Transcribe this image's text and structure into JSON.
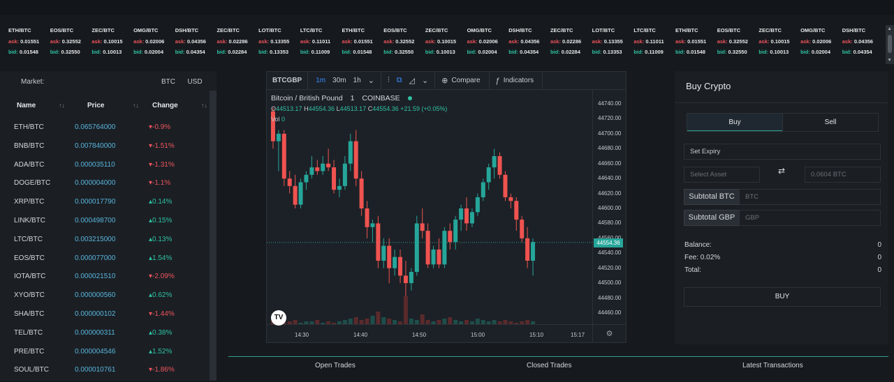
{
  "ticker": [
    {
      "pair": "ETH/BTC",
      "ask": "0.01551",
      "bid": "0.01548"
    },
    {
      "pair": "EOS/BTC",
      "ask": "0.32552",
      "bid": "0.32550"
    },
    {
      "pair": "ZEC/BTC",
      "ask": "0.10015",
      "bid": "0.10013"
    },
    {
      "pair": "OMG/BTC",
      "ask": "0.02006",
      "bid": "0.02004"
    },
    {
      "pair": "DSH/BTC",
      "ask": "0.04356",
      "bid": "0.04354"
    },
    {
      "pair": "ZEC/BTC",
      "ask": "0.02286",
      "bid": "0.02284"
    },
    {
      "pair": "LOT/BTC",
      "ask": "0.13355",
      "bid": "0.13353"
    },
    {
      "pair": "LTC/BTC",
      "ask": "0.11011",
      "bid": "0.11009"
    },
    {
      "pair": "ETH/BTC",
      "ask": "0.01551",
      "bid": "0.01548"
    },
    {
      "pair": "EOS/BTC",
      "ask": "0.32552",
      "bid": "0.32550"
    },
    {
      "pair": "ZEC/BTC",
      "ask": "0.10015",
      "bid": "0.10013"
    },
    {
      "pair": "OMG/BTC",
      "ask": "0.02006",
      "bid": "0.02004"
    },
    {
      "pair": "DSH/BTC",
      "ask": "0.04356",
      "bid": "0.04354"
    },
    {
      "pair": "ZEC/BTC",
      "ask": "0.02286",
      "bid": "0.02284"
    },
    {
      "pair": "LOT/BTC",
      "ask": "0.13355",
      "bid": "0.13353"
    },
    {
      "pair": "LTC/BTC",
      "ask": "0.11011",
      "bid": "0.11009"
    },
    {
      "pair": "ETH/BTC",
      "ask": "0.01551",
      "bid": "0.01548"
    },
    {
      "pair": "EOS/BTC",
      "ask": "0.32552",
      "bid": "0.32550"
    },
    {
      "pair": "ZEC/BTC",
      "ask": "0.10015",
      "bid": "0.10013"
    },
    {
      "pair": "OMG/BTC",
      "ask": "0.02006",
      "bid": "0.02004"
    },
    {
      "pair": "DSH/BTC",
      "ask": "0.04356",
      "bid": "0.04354"
    }
  ],
  "ticker_labels": {
    "ask": "ask:",
    "bid": "bid:"
  },
  "market": {
    "label": "Market:",
    "currencies": [
      "BTC",
      "USD"
    ],
    "columns": {
      "name": "Name",
      "price": "Price",
      "change": "Change"
    },
    "rows": [
      {
        "name": "ETH/BTC",
        "price": "0.065764000",
        "change": "-0.9%",
        "dir": "down"
      },
      {
        "name": "BNB/BTC",
        "price": "0.007840000",
        "change": "-1.51%",
        "dir": "down"
      },
      {
        "name": "ADA/BTC",
        "price": "0.000035110",
        "change": "-1.31%",
        "dir": "down"
      },
      {
        "name": "DOGE/BTC",
        "price": "0.000004000",
        "change": "-1.1%",
        "dir": "down"
      },
      {
        "name": "XRP/BTC",
        "price": "0.000017790",
        "change": "0.14%",
        "dir": "up"
      },
      {
        "name": "LINK/BTC",
        "price": "0.000498700",
        "change": "0.15%",
        "dir": "up"
      },
      {
        "name": "LTC/BTC",
        "price": "0.003215000",
        "change": "0.13%",
        "dir": "up"
      },
      {
        "name": "EOS/BTC",
        "price": "0.000077000",
        "change": "1.54%",
        "dir": "up"
      },
      {
        "name": "IOTA/BTC",
        "price": "0.000021510",
        "change": "-2.09%",
        "dir": "down"
      },
      {
        "name": "XYO/BTC",
        "price": "0.000000560",
        "change": "0.62%",
        "dir": "up"
      },
      {
        "name": "SHA/BTC",
        "price": "0.000000102",
        "change": "-1.44%",
        "dir": "down"
      },
      {
        "name": "TEL/BTC",
        "price": "0.000000311",
        "change": "0.38%",
        "dir": "up"
      },
      {
        "name": "PRE/BTC",
        "price": "0.000004546",
        "change": "1.52%",
        "dir": "up"
      },
      {
        "name": "SOUL/BTC",
        "price": "0.000010761",
        "change": "-1.86%",
        "dir": "down"
      }
    ]
  },
  "chart_toolbar": {
    "symbol": "BTCGBP",
    "timeframes": [
      "1m",
      "30m",
      "1h"
    ],
    "compare": "Compare",
    "indicators": "Indicators"
  },
  "chart_info": {
    "title": "Bitcoin / British Pound",
    "interval": "1",
    "exchange": "COINBASE",
    "o_label": "O",
    "o": "44513.17",
    "h_label": "H",
    "h": "44554.36",
    "l_label": "L",
    "l": "44513.17",
    "c_label": "C",
    "c": "44554.36",
    "change": "+21.59 (+0.05%)",
    "vol_label": "Vol",
    "vol": "0"
  },
  "chart_data": {
    "type": "candlestick",
    "y_ticks": [
      "44740.00",
      "44720.00",
      "44700.00",
      "44680.00",
      "44660.00",
      "44640.00",
      "44620.00",
      "44600.00",
      "44580.00",
      "44560.00",
      "44540.00",
      "44520.00",
      "44500.00",
      "44480.00",
      "44460.00"
    ],
    "x_ticks": [
      "14:30",
      "14:40",
      "14:50",
      "15:00",
      "15:10",
      "15:17"
    ],
    "last_price": "44554.36",
    "ylim": [
      44450,
      44750
    ],
    "candles": [
      [
        44730,
        44735,
        44680,
        44690
      ],
      [
        44690,
        44705,
        44650,
        44700
      ],
      [
        44700,
        44705,
        44630,
        44640
      ],
      [
        44640,
        44650,
        44620,
        44630
      ],
      [
        44630,
        44645,
        44600,
        44605
      ],
      [
        44605,
        44640,
        44600,
        44635
      ],
      [
        44635,
        44650,
        44625,
        44645
      ],
      [
        44645,
        44670,
        44640,
        44655
      ],
      [
        44655,
        44665,
        44645,
        44650
      ],
      [
        44650,
        44670,
        44645,
        44660
      ],
      [
        44660,
        44680,
        44650,
        44655
      ],
      [
        44655,
        44665,
        44620,
        44625
      ],
      [
        44625,
        44640,
        44615,
        44630
      ],
      [
        44630,
        44670,
        44625,
        44660
      ],
      [
        44660,
        44700,
        44650,
        44690
      ],
      [
        44690,
        44705,
        44630,
        44640
      ],
      [
        44640,
        44650,
        44590,
        44600
      ],
      [
        44600,
        44610,
        44560,
        44575
      ],
      [
        44575,
        44585,
        44555,
        44580
      ],
      [
        44580,
        44590,
        44520,
        44530
      ],
      [
        44530,
        44560,
        44520,
        44550
      ],
      [
        44550,
        44560,
        44500,
        44520
      ],
      [
        44520,
        44545,
        44510,
        44535
      ],
      [
        44535,
        44545,
        44500,
        44510
      ],
      [
        44510,
        44530,
        44460,
        44500
      ],
      [
        44500,
        44520,
        44490,
        44515
      ],
      [
        44515,
        44590,
        44510,
        44580
      ],
      [
        44580,
        44600,
        44560,
        44570
      ],
      [
        44570,
        44580,
        44520,
        44525
      ],
      [
        44525,
        44550,
        44520,
        44545
      ],
      [
        44545,
        44560,
        44520,
        44525
      ],
      [
        44525,
        44575,
        44520,
        44570
      ],
      [
        44570,
        44580,
        44545,
        44555
      ],
      [
        44555,
        44590,
        44545,
        44585
      ],
      [
        44585,
        44605,
        44570,
        44600
      ],
      [
        44600,
        44615,
        44570,
        44580
      ],
      [
        44580,
        44600,
        44575,
        44595
      ],
      [
        44595,
        44620,
        44590,
        44615
      ],
      [
        44615,
        44640,
        44610,
        44635
      ],
      [
        44635,
        44660,
        44625,
        44655
      ],
      [
        44655,
        44680,
        44640,
        44670
      ],
      [
        44670,
        44675,
        44640,
        44645
      ],
      [
        44645,
        44650,
        44610,
        44615
      ],
      [
        44615,
        44620,
        44600,
        44610
      ],
      [
        44610,
        44615,
        44570,
        44585
      ],
      [
        44585,
        44590,
        44555,
        44560
      ],
      [
        44560,
        44575,
        44520,
        44530
      ],
      [
        44530,
        44560,
        44510,
        44555
      ]
    ],
    "volumes": [
      2,
      1,
      1,
      2,
      3,
      1,
      2,
      2,
      3,
      1,
      2,
      1,
      2,
      3,
      4,
      5,
      3,
      4,
      6,
      9,
      5,
      4,
      3,
      2,
      20,
      4,
      3,
      7,
      3,
      2,
      3,
      4,
      5,
      3,
      2,
      3,
      2,
      4,
      3,
      2,
      3,
      2,
      3,
      2,
      1,
      2,
      3,
      2
    ]
  },
  "tabs": [
    "Open Trades",
    "Closed Trades",
    "Latest Transactions"
  ],
  "buy_panel": {
    "title": "Buy Crypto",
    "buy_tab": "Buy",
    "sell_tab": "Sell",
    "expiry": "Set Expiry",
    "select_asset": "Select Asset",
    "amount_placeholder": "0.0604 BTC",
    "swap": "⇄",
    "subtotal_btc": "Subtotal BTC",
    "subtotal_btc_ph": "BTC",
    "subtotal_gbp": "Subtotal GBP",
    "subtotal_gbp_ph": "GBP",
    "balance_label": "Balance:",
    "balance": "0",
    "fee_label": "Fee: 0.02%",
    "fee": "0",
    "total_label": "Total:",
    "total": "0",
    "buy_button": "BUY"
  },
  "colors": {
    "up": "#26a69a",
    "down": "#ef5350",
    "accent": "#2ea08f"
  }
}
